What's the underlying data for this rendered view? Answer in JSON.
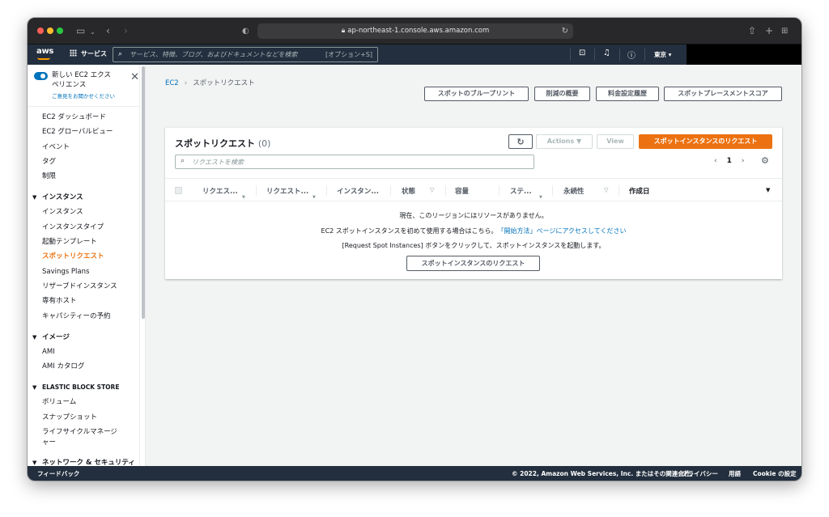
{
  "browser": {
    "url": "ap-northeast-1.console.aws.amazon.com"
  },
  "topnav": {
    "logo": "aws",
    "services": "サービス",
    "search_placeholder": "サービス、特徴、ブログ、およびドキュメントなどを検索",
    "search_shortcut": "[オプション+S]",
    "region": "東京 ▾"
  },
  "sidebar": {
    "toggle_label": "新しい EC2 エクスペリエンス",
    "feedback": "ご意見をお聞かせください",
    "top_items": [
      "EC2 ダッシュボード",
      "EC2 グローバルビュー",
      "イベント",
      "タグ",
      "制限"
    ],
    "sec_instances": "インスタンス",
    "instance_items": [
      "インスタンス",
      "インスタンスタイプ",
      "起動テンプレート",
      "スポットリクエスト",
      "Savings Plans",
      "リザーブドインスタンス",
      "専有ホスト",
      "キャパシティーの予約"
    ],
    "sec_images": "イメージ",
    "image_items": [
      "AMI",
      "AMI カタログ"
    ],
    "sec_ebs": "ELASTIC BLOCK STORE",
    "ebs_items": [
      "ボリューム",
      "スナップショット",
      "ライフサイクルマネージャー"
    ],
    "sec_network": "ネットワーク & セキュリティ"
  },
  "breadcrumb": {
    "root": "EC2",
    "current": "スポットリクエスト"
  },
  "header_buttons": {
    "blueprint": "スポットのブループリント",
    "savings": "削減の概要",
    "pricing": "料金設定履歴",
    "placement": "スポットプレースメントスコア"
  },
  "panel": {
    "title": "スポットリクエスト",
    "count": "(0)",
    "actions": "Actions ▼",
    "view": "View",
    "request": "スポットインスタンスのリクエスト",
    "filter_placeholder": "リクエストを検索",
    "page": "1",
    "columns": [
      "リクエス...",
      "リクエスト...",
      "インスタン...",
      "状態",
      "容量",
      "ステ...",
      "永続性",
      "作成日"
    ],
    "empty_line1": "現在、このリージョンにはリソースがありません。",
    "empty_line2_pre": "EC2 スポットインスタンスを初めて使用する場合はこちら。",
    "empty_line2_link": "「開始方法」ページにアクセスしてください",
    "empty_line3": "[Request Spot Instances] ボタンをクリックして、スポットインスタンスを起動します。",
    "empty_button": "スポットインスタンスのリクエスト"
  },
  "footer": {
    "feedback": "フィードバック",
    "copyright": "© 2022, Amazon Web Services, Inc. またはその関連会社。",
    "privacy": "プライバシー",
    "terms": "用語",
    "cookie": "Cookie の設定"
  }
}
